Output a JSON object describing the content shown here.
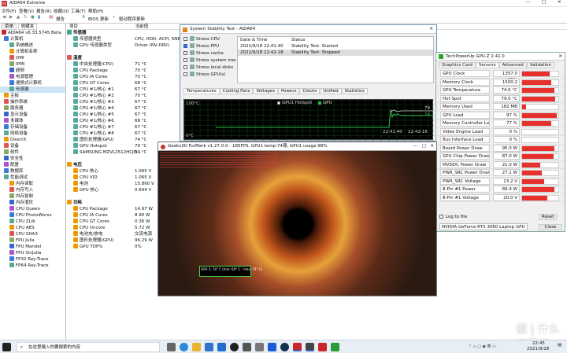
{
  "app": {
    "title": "AIDA64 Extreme",
    "menus": [
      "文件(F)",
      "查看(V)",
      "报告(R)",
      "收藏(O)",
      "工具(T)",
      "帮助(H)"
    ],
    "toolbar": {
      "report": "报告",
      "bios": "BIOS 更新",
      "driver": "驱动程序更新"
    },
    "tabs": [
      "菜单",
      "收藏夹"
    ],
    "version": "AIDA64 v6.33.5745 Beta"
  },
  "tree": [
    "计算机",
    "系统概述",
    "计算机名称",
    "DMI",
    "IPMI",
    "超频",
    "电源管理",
    "便携式计算机",
    "传感器",
    "主板",
    "操作系统",
    "服务器",
    "显示设备",
    "多媒体",
    "存储设备",
    "网络设备",
    "DirectX",
    "设备",
    "软件",
    "安全性",
    "配置",
    "数据库",
    "性能测试",
    "内存读取",
    "内存写入",
    "内存复制",
    "内存潜伏",
    "CPU Queen",
    "CPU PhotoWorxx",
    "CPU ZLib",
    "CPU AES",
    "CPU SHA3",
    "FPU Julia",
    "FPU Mandel",
    "FPU SinJulia",
    "FP32 Ray-Trace",
    "FP64 Ray-Trace"
  ],
  "detail": {
    "header": [
      "项目",
      "当前值"
    ],
    "sensors_title": "传感器",
    "sensor_type_k": "传感器类型",
    "sensor_type_v": "CPU, HDD, ACPI, SNB",
    "gpu_sensor_k": "GPU 传感器类型",
    "gpu_sensor_v": "Driver (NV-DRV)",
    "temp_title": "温度",
    "temps": [
      [
        "中央处理器(CPU)",
        "71 °C"
      ],
      [
        "CPU Package",
        "70 °C"
      ],
      [
        "CPU IA Cores",
        "70 °C"
      ],
      [
        "CPU GT Cores",
        "68 °C"
      ],
      [
        "CPU #1/核心 #1",
        "67 °C"
      ],
      [
        "CPU #1/核心 #2",
        "70 °C"
      ],
      [
        "CPU #1/核心 #3",
        "67 °C"
      ],
      [
        "CPU #1/核心 #4",
        "67 °C"
      ],
      [
        "CPU #1/核心 #5",
        "67 °C"
      ],
      [
        "CPU #1/核心 #6",
        "68 °C"
      ],
      [
        "CPU #1/核心 #7",
        "67 °C"
      ],
      [
        "CPU #1/核心 #8",
        "67 °C"
      ],
      [
        "图形处理器(GPU)",
        "74 °C"
      ],
      [
        "GPU Hotspot",
        "79 °C"
      ],
      [
        "SAMSUNG MZVL2512HCJQ-...",
        "50 °C"
      ]
    ],
    "volt_title": "电压",
    "volts": [
      [
        "CPU 核心",
        "1.065 V"
      ],
      [
        "CPU VID",
        "1.065 V"
      ],
      [
        "电池",
        "15.860 V"
      ],
      [
        "GPU 核心",
        "0.694 V"
      ]
    ],
    "power_title": "功耗",
    "powers": [
      [
        "CPU Package",
        "14.97 W"
      ],
      [
        "CPU IA Cores",
        "8.90 W"
      ],
      [
        "CPU GT Cores",
        "0.36 W"
      ],
      [
        "CPU Uncore",
        "5.72 W"
      ],
      [
        "电池充/放电",
        "交流电源"
      ],
      [
        "图形处理器(GPU)",
        "96.29 W"
      ],
      [
        "GPU TDP%",
        "0%"
      ]
    ]
  },
  "stability": {
    "title": "System Stability Test - AIDA64",
    "options": [
      [
        "Stress CPU",
        false
      ],
      [
        "Stress FPU",
        true
      ],
      [
        "Stress cache",
        false
      ],
      [
        "Stress system memory",
        false
      ],
      [
        "Stress local disks",
        false
      ],
      [
        "Stress GPU(s)",
        false
      ]
    ],
    "log_headers": [
      "Date & Time",
      "Status"
    ],
    "log": [
      [
        "2021/9/18 22:41:40",
        "Stability Test: Started"
      ],
      [
        "2021/9/18 22:42:18",
        "Stability Test: Stopped"
      ]
    ],
    "tabs": [
      "Temperatures",
      "Cooling Fans",
      "Voltages",
      "Powers",
      "Clocks",
      "Unified",
      "Statistics"
    ],
    "legend": [
      "GPU1 Hotspot",
      "GPU"
    ],
    "graph_top": "100°C",
    "graph_bottom": "0°C",
    "times": [
      "22:41:40",
      "22:42:18"
    ],
    "readings": [
      "79",
      "74"
    ]
  },
  "gpuz": {
    "title": "TechPowerUp GPU-Z 2.41.0",
    "tabs": [
      "Graphics Card",
      "Sensors",
      "Advanced",
      "Validation"
    ],
    "rows": [
      [
        "GPU Clock",
        "1357.0 MHz",
        0.75
      ],
      [
        "Memory Clock",
        "1500.2 MHz",
        0.8
      ],
      [
        "GPU Temperature",
        "74.0 °C",
        0.9
      ],
      [
        "Hot Spot",
        "79.0 °C",
        0.92
      ],
      [
        "Memory Used",
        "182 MB",
        0.1
      ],
      [
        "GPU Load",
        "97 %",
        0.95
      ],
      [
        "Memory Controller Load",
        "77 %",
        0.8
      ],
      [
        "Video Engine Load",
        "0 %",
        0
      ],
      [
        "Bus Interface Load",
        "0 %",
        0
      ],
      [
        "Board Power Draw",
        "95.0 W",
        0.9
      ],
      [
        "GPU Chip Power Draw",
        "87.0 W",
        0.88
      ],
      [
        "MVDDC Power Draw",
        "21.0 W",
        0.5
      ],
      [
        "PWR_SRC Power Draw",
        "27.1 W",
        0.55
      ],
      [
        "PWR_SRC Voltage",
        "13.2 V",
        0.6
      ],
      [
        "8-Pin #1 Power",
        "89.9 W",
        0.9
      ],
      [
        "8-Pin #1 Voltage",
        "20.0 V",
        0.7
      ]
    ],
    "log": "Log to file",
    "reset": "Reset",
    "gpu": "NVIDIA GeForce RTX 3060 Laptop GPU",
    "close": "Close"
  },
  "furmark": {
    "title": "Geeks3D FurMark v1.27.0.0 - 185FPS, GPU1 temp:74璁, GPU1 usage:98%",
    "overlay": "GPU 1: 74° C (min: 69° C - max: 74° C)"
  },
  "taskbar": {
    "search": "在这里输入你要搜索的内容",
    "time": "22:45",
    "date": "2021/9/18"
  },
  "colors": {
    "accent": "#e8302c",
    "graph_green": "#2db84a"
  }
}
